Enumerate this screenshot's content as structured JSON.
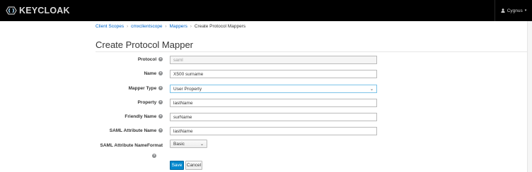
{
  "header": {
    "brand": "KEYCLOAK",
    "user_name": "Cygnus"
  },
  "breadcrumb": {
    "items": [
      "Client Scopes",
      "cmxclientscope",
      "Mappers"
    ],
    "current": "Create Protocol Mappers"
  },
  "page": {
    "title": "Create Protocol Mapper"
  },
  "form": {
    "protocol": {
      "label": "Protocol",
      "value": "saml"
    },
    "name": {
      "label": "Name",
      "value": "X500 surname"
    },
    "mapper_type": {
      "label": "Mapper Type",
      "value": "User Property"
    },
    "property": {
      "label": "Property",
      "value": "lastName"
    },
    "friendly_name": {
      "label": "Friendly Name",
      "value": "surName"
    },
    "saml_attribute_name": {
      "label": "SAML Attribute Name",
      "value": "lastName"
    },
    "saml_attribute_nameformat": {
      "label": "SAML Attribute NameFormat",
      "value": "Basic"
    }
  },
  "actions": {
    "save": "Save",
    "cancel": "Cancel"
  },
  "icons": {
    "help": "help-icon",
    "user": "user-icon",
    "logo": "keycloak-logo-icon",
    "chevron": "chevron-down-icon"
  },
  "colors": {
    "header_bg": "#000000",
    "link": "#0066cc",
    "primary_button": "#0088ce",
    "focus_border": "#7dc3e8"
  }
}
